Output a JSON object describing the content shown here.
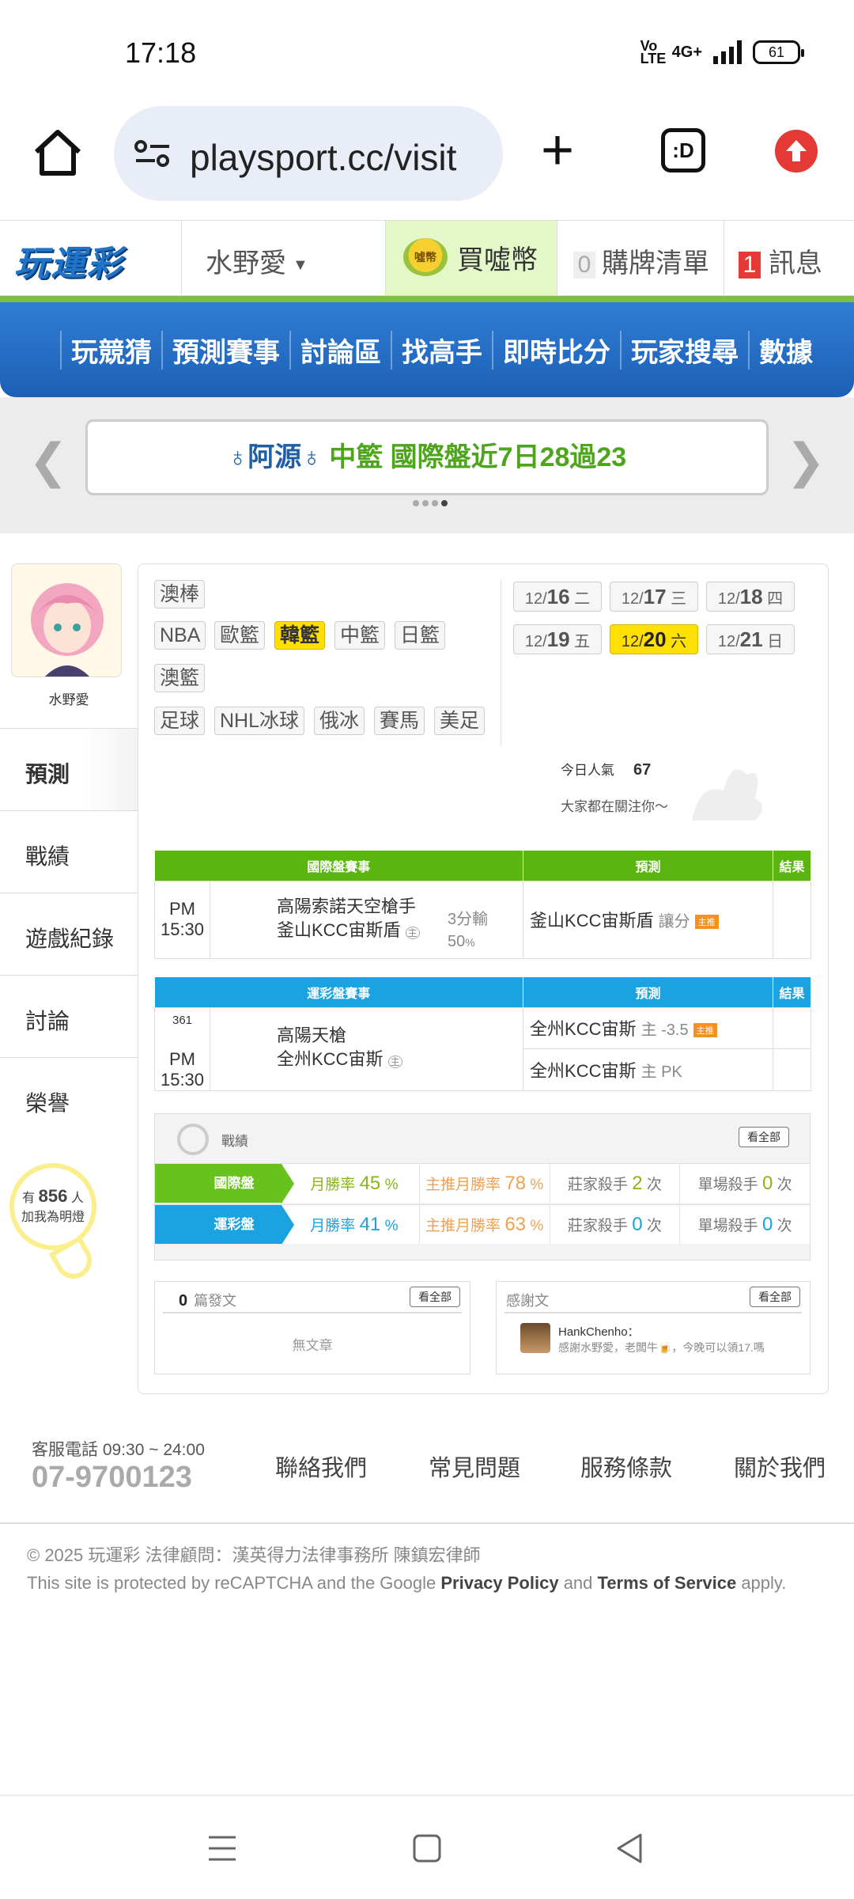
{
  "status_bar": {
    "time": "17:18",
    "volte": "Vo LTE",
    "network": "4G+",
    "battery": "61"
  },
  "browser": {
    "url": "playsport.cc/visit",
    "tab_button": ":D"
  },
  "site_header": {
    "logo": "玩運彩",
    "user": "水野愛",
    "buy_coin": "買噓幣",
    "coin_icon": "噓幣",
    "cart_count": "0",
    "cart_label": "購牌清單",
    "msg_count": "1",
    "msg_label": "訊息"
  },
  "nav": [
    "玩競猜",
    "預測賽事",
    "討論區",
    "找高手",
    "即時比分",
    "玩家搜尋",
    "數據"
  ],
  "ticker": {
    "name": "♁阿源♁",
    "text": "中籃 國際盤近7日28過23"
  },
  "sidebar": {
    "username": "水野愛",
    "menu": [
      "預測",
      "戰績",
      "遊戲紀錄",
      "討論",
      "榮譽"
    ],
    "bulb": {
      "prefix": "有",
      "count": "856",
      "suffix": "人",
      "caption": "加我為明燈"
    }
  },
  "categories": {
    "row1": [
      "澳棒"
    ],
    "row2": [
      "NBA",
      "歐籃",
      "韓籃",
      "中籃",
      "日籃"
    ],
    "row3": [
      "澳籃"
    ],
    "row4": [
      "足球",
      "NHL冰球",
      "俄冰",
      "賽馬",
      "美足"
    ],
    "selected": "韓籃"
  },
  "dates": [
    {
      "m": "12/",
      "d": "16",
      "w": "二"
    },
    {
      "m": "12/",
      "d": "17",
      "w": "三"
    },
    {
      "m": "12/",
      "d": "18",
      "w": "四"
    },
    {
      "m": "12/",
      "d": "19",
      "w": "五"
    },
    {
      "m": "12/",
      "d": "20",
      "w": "六"
    },
    {
      "m": "12/",
      "d": "21",
      "w": "日"
    }
  ],
  "popularity": {
    "label": "今日人氣",
    "value": "67",
    "note": "大家都在關注你～"
  },
  "intl_table": {
    "headers": [
      "國際盤賽事",
      "預測",
      "結果"
    ],
    "row": {
      "time": "PM 15:30",
      "away": "高陽索諾天空槍手",
      "home": "釜山KCC宙斯盾",
      "home_mark": "主",
      "odds_line1": "3分輸",
      "odds_line2": "50",
      "odds_unit": "%",
      "pick": "釜山KCC宙斯盾",
      "pick_detail": "讓分",
      "badge": "主推"
    }
  },
  "sport_table": {
    "headers": [
      "運彩盤賽事",
      "預測",
      "結果"
    ],
    "row": {
      "num": "361",
      "time": "PM 15:30",
      "away": "高陽天槍",
      "home": "全州KCC宙斯",
      "home_mark": "主",
      "pick1": "全州KCC宙斯",
      "pick1_detail": "主 -3.5",
      "badge": "主推",
      "pick2": "全州KCC宙斯",
      "pick2_detail": "主 PK"
    }
  },
  "stats": {
    "title": "戰績",
    "view_all": "看全部",
    "rows": [
      {
        "label": "國際盤",
        "win_label": "月勝率",
        "win": "45",
        "main_label": "主推月勝率",
        "main": "78",
        "dealer_label": "莊家殺手",
        "dealer": "2",
        "single_label": "單場殺手",
        "single": "0",
        "pct": "%",
        "times": "次"
      },
      {
        "label": "運彩盤",
        "win_label": "月勝率",
        "win": "41",
        "main_label": "主推月勝率",
        "main": "63",
        "dealer_label": "莊家殺手",
        "dealer": "0",
        "single_label": "單場殺手",
        "single": "0",
        "pct": "%",
        "times": "次"
      }
    ]
  },
  "posts": {
    "count": "0",
    "label": "篇發文",
    "view_all": "看全部",
    "empty": "無文章"
  },
  "thanks": {
    "label": "感謝文",
    "view_all": "看全部",
    "user": "HankChenho：",
    "text": "感謝水野愛，老闆牛🍺，今晚可以領17.嗎"
  },
  "footer": {
    "hours": "客服電話 09:30 ~ 24:00",
    "phone": "07-9700123",
    "links": [
      "聯絡我們",
      "常見問題",
      "服務條款",
      "關於我們"
    ],
    "copyright": "© 2025 玩運彩 法律顧問：漢英得力法律事務所 陳鎮宏律師",
    "recaptcha_pre": "This site is protected by reCAPTCHA and the Google ",
    "privacy": "Privacy Policy",
    "and": " and ",
    "terms": "Terms of Service",
    "apply": " apply."
  },
  "colors": {
    "green": "#5bb510",
    "blue": "#1aa3e0",
    "nav_blue": "#2f7ed4",
    "yellow": "#ffe000"
  }
}
